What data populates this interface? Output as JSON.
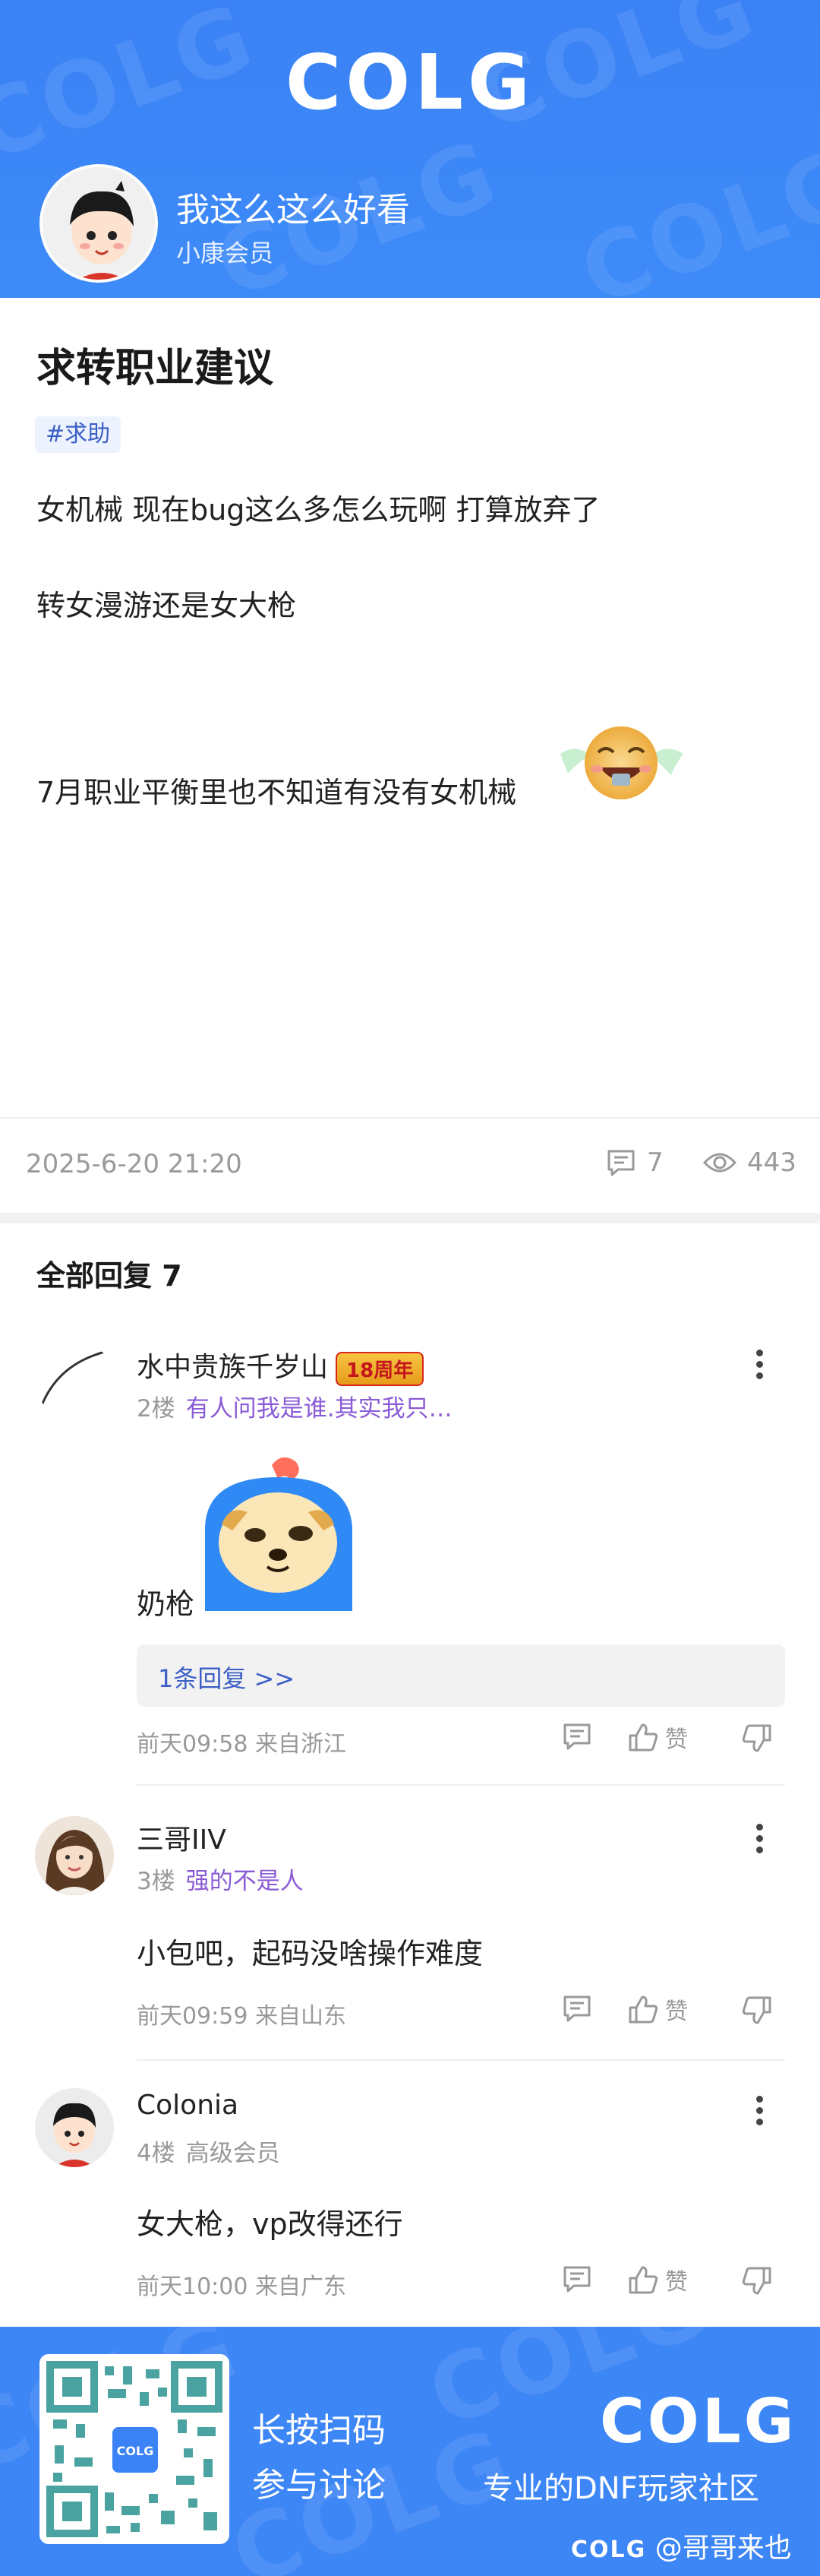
{
  "header": {
    "logo": "COLG",
    "author_name": "我这么这么好看",
    "author_level": "小康会员"
  },
  "post": {
    "title": "求转职业建议",
    "tag": "#求助",
    "lines": [
      "女机械 现在bug这么多怎么玩啊 打算放弃了",
      "转女漫游还是女大枪",
      "7月职业平衡里也不知道有没有女机械"
    ],
    "date": "2025-6-20 21:20",
    "comment_count": "7",
    "view_count": "443"
  },
  "replies_header": "全部回复  7",
  "replies": [
    {
      "name": "水中贵族千岁山",
      "badge": "18周年",
      "floor": "2楼",
      "signature": "有人问我是谁.其实我只…",
      "content": "奶枪",
      "sub_reply": "1条回复 >>",
      "time_loc": "前天09:58 来自浙江",
      "like_label": "赞"
    },
    {
      "name": "三哥IIV",
      "floor": "3楼",
      "signature": "强的不是人",
      "content": "小包吧，起码没啥操作难度",
      "time_loc": "前天09:59 来自山东",
      "like_label": "赞"
    },
    {
      "name": "Colonia",
      "floor": "4楼",
      "signature": "高级会员",
      "content": "女大枪，vp改得还行",
      "time_loc": "前天10:00 来自广东",
      "like_label": "赞"
    }
  ],
  "footer": {
    "scan_line1": "长按扫码",
    "scan_line2": "参与讨论",
    "logo": "COLG",
    "slogan": "专业的DNF玩家社区",
    "credit_logo": "COLG",
    "credit_user": "@哥哥来也",
    "qr_logo": "COLG"
  },
  "colors": {
    "brand_blue": "#3b82f6",
    "tag_text": "#3c5fc6",
    "signature_purple": "#8a5bd6"
  }
}
